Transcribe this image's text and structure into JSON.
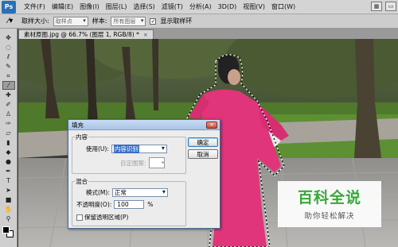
{
  "app": {
    "logo": "Ps"
  },
  "menu": [
    "文件(F)",
    "编辑(E)",
    "图像(I)",
    "图层(L)",
    "选择(S)",
    "滤镜(T)",
    "分析(A)",
    "3D(D)",
    "视图(V)",
    "窗口(W)"
  ],
  "options_bar": {
    "sample_size_label": "取样大小:",
    "sample_size_value": "取样点",
    "sample_label": "样本:",
    "sample_value": "所有图层",
    "show_ring_label": "显示取样环",
    "show_ring_checked": true
  },
  "document": {
    "tab_title": "素材原图.jpg @ 66.7% (图层 1, RGB/8) *",
    "close": "×"
  },
  "dialog": {
    "title": "填充",
    "close": "×",
    "contents_legend": "内容",
    "use_label": "使用(U):",
    "use_value": "内容识别",
    "custom_pattern_label": "自定图案:",
    "blending_legend": "混合",
    "mode_label": "模式(M):",
    "mode_value": "正常",
    "opacity_label": "不透明度(O):",
    "opacity_value": "100",
    "opacity_unit": "%",
    "preserve_label": "保留透明区域(P)",
    "preserve_checked": false,
    "ok_label": "确定",
    "cancel_label": "取消"
  },
  "watermark": {
    "title": "百科全说",
    "subtitle": "助你轻松解决",
    "color": "#37a93a"
  },
  "tools": [
    "move-icon",
    "marquee-icon",
    "lasso-icon",
    "quick-select-icon",
    "crop-icon",
    "eyedropper-icon",
    "healing-icon",
    "brush-icon",
    "clone-stamp-icon",
    "history-brush-icon",
    "eraser-icon",
    "gradient-icon",
    "blur-icon",
    "dodge-icon",
    "pen-icon",
    "type-icon",
    "path-select-icon",
    "shape-icon",
    "hand-icon",
    "zoom-icon"
  ]
}
